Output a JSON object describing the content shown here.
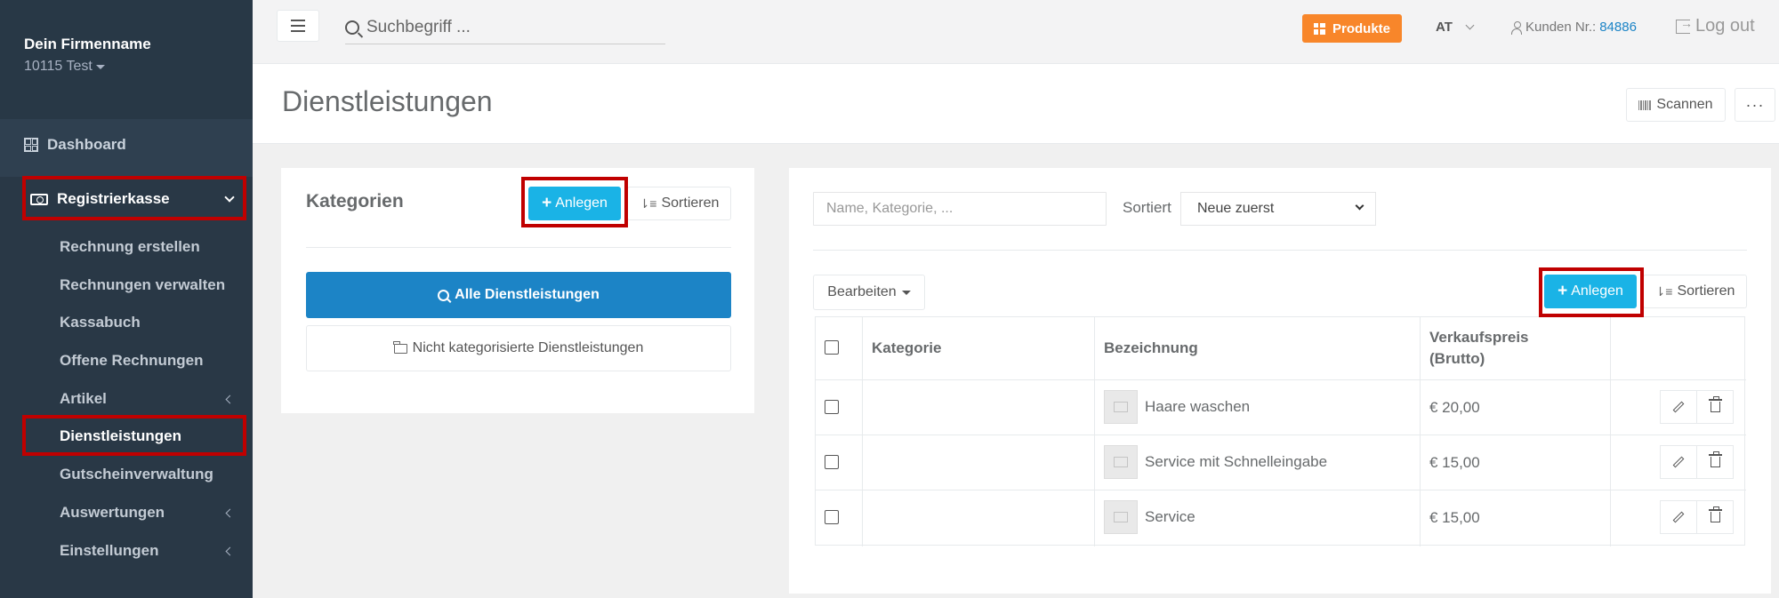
{
  "sidebar": {
    "company": "Dein Firmenname",
    "account": "10115 Test",
    "dashboard": "Dashboard",
    "section": "Registrierkasse",
    "items": [
      {
        "label": "Rechnung erstellen",
        "submenu": false
      },
      {
        "label": "Rechnungen verwalten",
        "submenu": false
      },
      {
        "label": "Kassabuch",
        "submenu": false
      },
      {
        "label": "Offene Rechnungen",
        "submenu": false
      },
      {
        "label": "Artikel",
        "submenu": true
      },
      {
        "label": "Dienstleistungen",
        "submenu": false,
        "active": true
      },
      {
        "label": "Gutscheinverwaltung",
        "submenu": false
      },
      {
        "label": "Auswertungen",
        "submenu": true
      },
      {
        "label": "Einstellungen",
        "submenu": true
      }
    ]
  },
  "topbar": {
    "search_placeholder": "Suchbegriff ...",
    "produkte": "Produkte",
    "lang": "AT",
    "kunden_label": "Kunden Nr.:",
    "kunden_nr": "84886",
    "logout": "Log out"
  },
  "header": {
    "title": "Dienstleistungen",
    "scan": "Scannen",
    "more": "···"
  },
  "categories": {
    "title": "Kategorien",
    "add": "Anlegen",
    "sort": "Sortieren",
    "all": "Alle Dienstleistungen",
    "uncategorized": "Nicht kategorisierte Dienstleistungen"
  },
  "list": {
    "filter_placeholder": "Name, Kategorie, ...",
    "sort_label": "Sortiert",
    "sort_value": "Neue zuerst",
    "bearbeiten": "Bearbeiten",
    "add": "Anlegen",
    "sort": "Sortieren",
    "columns": {
      "kategorie": "Kategorie",
      "bezeichnung": "Bezeichnung",
      "preis_line1": "Verkaufspreis",
      "preis_line2": "(Brutto)"
    },
    "rows": [
      {
        "kategorie": "",
        "bezeichnung": "Haare waschen",
        "preis": "€ 20,00"
      },
      {
        "kategorie": "",
        "bezeichnung": "Service mit Schnelleingabe",
        "preis": "€ 15,00"
      },
      {
        "kategorie": "",
        "bezeichnung": "Service",
        "preis": "€ 15,00"
      }
    ]
  },
  "colors": {
    "sidebar_bg": "#2f4050",
    "primary": "#1c84c6",
    "info": "#1ab3e6",
    "warning": "#f8862a",
    "highlight": "#c00000"
  }
}
